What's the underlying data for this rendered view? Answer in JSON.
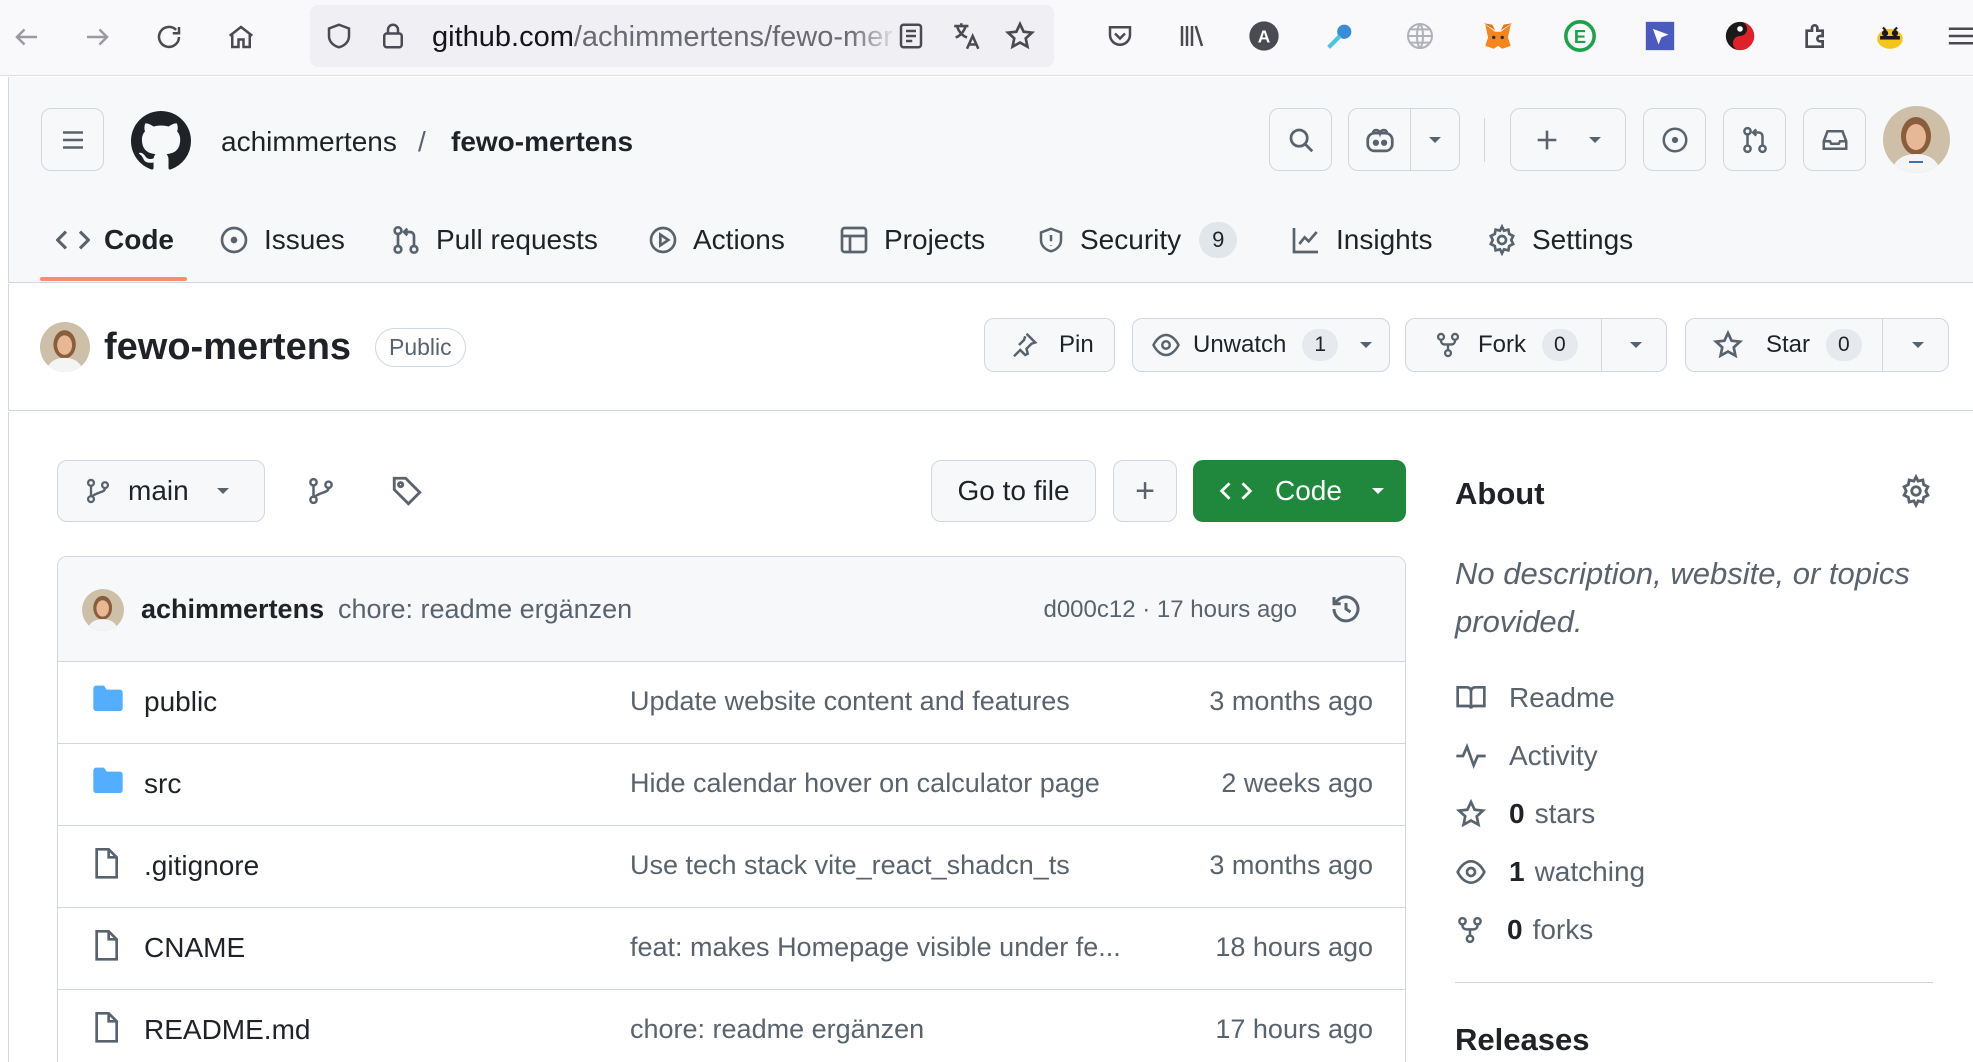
{
  "browser": {
    "url_host": "github.com",
    "url_path": "/achimmertens/fewo-mer"
  },
  "header": {
    "owner": "achimmertens",
    "separator": "/",
    "repo": "fewo-mertens"
  },
  "tabs": [
    {
      "label": "Code",
      "icon": "code-icon",
      "active": true
    },
    {
      "label": "Issues",
      "icon": "issue-icon"
    },
    {
      "label": "Pull requests",
      "icon": "pull-request-icon"
    },
    {
      "label": "Actions",
      "icon": "play-icon"
    },
    {
      "label": "Projects",
      "icon": "table-icon"
    },
    {
      "label": "Security",
      "icon": "shield-icon",
      "count": "9"
    },
    {
      "label": "Insights",
      "icon": "graph-icon"
    },
    {
      "label": "Settings",
      "icon": "gear-icon"
    }
  ],
  "repo_head": {
    "name": "fewo-mertens",
    "visibility": "Public",
    "pin_label": "Pin",
    "unwatch_label": "Unwatch",
    "unwatch_count": "1",
    "fork_label": "Fork",
    "fork_count": "0",
    "star_label": "Star",
    "star_count": "0"
  },
  "toolbar": {
    "branch": "main",
    "go_to_file": "Go to file",
    "add": "+",
    "code": "Code"
  },
  "last_commit": {
    "author": "achimmertens",
    "message": "chore: readme ergänzen",
    "meta": "d000c12 · 17 hours ago"
  },
  "files": [
    {
      "name": "public",
      "type": "folder",
      "message": "Update website content and features",
      "date": "3 months ago"
    },
    {
      "name": "src",
      "type": "folder",
      "message": "Hide calendar hover on calculator page",
      "date": "2 weeks ago"
    },
    {
      "name": ".gitignore",
      "type": "file",
      "message": "Use tech stack vite_react_shadcn_ts",
      "date": "3 months ago"
    },
    {
      "name": "CNAME",
      "type": "file",
      "message": "feat: makes Homepage visible under fe...",
      "date": "18 hours ago"
    },
    {
      "name": "README.md",
      "type": "file",
      "message": "chore: readme ergänzen",
      "date": "17 hours ago"
    }
  ],
  "about": {
    "title": "About",
    "description": "No description, website, or topics provided.",
    "readme": "Readme",
    "activity": "Activity",
    "stars_count": "0",
    "stars_label": "stars",
    "watching_count": "1",
    "watching_label": "watching",
    "forks_count": "0",
    "forks_label": "forks",
    "releases": "Releases"
  },
  "colors": {
    "accent_tab": "#fd8c73",
    "code_button": "#1f883d",
    "folder": "#54aeff"
  }
}
